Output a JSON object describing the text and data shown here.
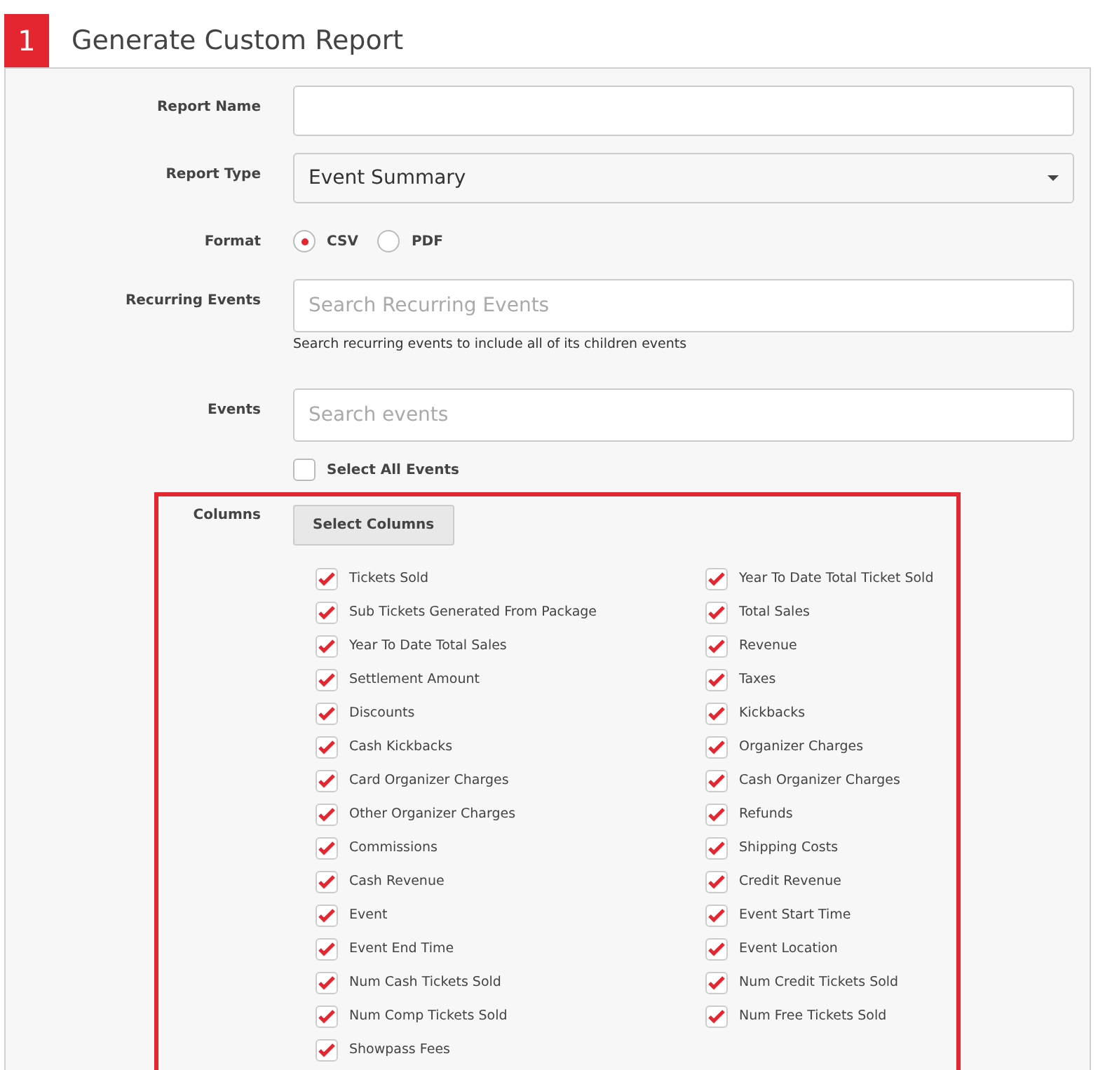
{
  "header": {
    "step": "1",
    "title": "Generate Custom Report"
  },
  "form": {
    "report_name": {
      "label": "Report Name"
    },
    "report_type": {
      "label": "Report Type",
      "value": "Event Summary"
    },
    "format": {
      "label": "Format",
      "options": [
        {
          "label": "CSV",
          "selected": true
        },
        {
          "label": "PDF",
          "selected": false
        }
      ]
    },
    "recurring_events": {
      "label": "Recurring Events",
      "placeholder": "Search Recurring Events",
      "hint": "Search recurring events to include all of its children events"
    },
    "events": {
      "label": "Events",
      "placeholder": "Search events",
      "select_all": {
        "label": "Select All Events",
        "checked": false
      }
    },
    "columns": {
      "label": "Columns",
      "button": "Select Columns",
      "highlighted": true,
      "items": [
        {
          "label": "Tickets Sold",
          "checked": true
        },
        {
          "label": "Year To Date Total Ticket Sold",
          "checked": true
        },
        {
          "label": "Sub Tickets Generated From Package",
          "checked": true
        },
        {
          "label": "Total Sales",
          "checked": true
        },
        {
          "label": "Year To Date Total Sales",
          "checked": true
        },
        {
          "label": "Revenue",
          "checked": true
        },
        {
          "label": "Settlement Amount",
          "checked": true
        },
        {
          "label": "Taxes",
          "checked": true
        },
        {
          "label": "Discounts",
          "checked": true
        },
        {
          "label": "Kickbacks",
          "checked": true
        },
        {
          "label": "Cash Kickbacks",
          "checked": true
        },
        {
          "label": "Organizer Charges",
          "checked": true
        },
        {
          "label": "Card Organizer Charges",
          "checked": true
        },
        {
          "label": "Cash Organizer Charges",
          "checked": true
        },
        {
          "label": "Other Organizer Charges",
          "checked": true
        },
        {
          "label": "Refunds",
          "checked": true
        },
        {
          "label": "Commissions",
          "checked": true
        },
        {
          "label": "Shipping Costs",
          "checked": true
        },
        {
          "label": "Cash Revenue",
          "checked": true
        },
        {
          "label": "Credit Revenue",
          "checked": true
        },
        {
          "label": "Event",
          "checked": true
        },
        {
          "label": "Event Start Time",
          "checked": true
        },
        {
          "label": "Event End Time",
          "checked": true
        },
        {
          "label": "Event Location",
          "checked": true
        },
        {
          "label": "Num Cash Tickets Sold",
          "checked": true
        },
        {
          "label": "Num Credit Tickets Sold",
          "checked": true
        },
        {
          "label": "Num Comp Tickets Sold",
          "checked": true
        },
        {
          "label": "Num Free Tickets Sold",
          "checked": true
        },
        {
          "label": "Showpass Fees",
          "checked": true
        }
      ]
    }
  }
}
